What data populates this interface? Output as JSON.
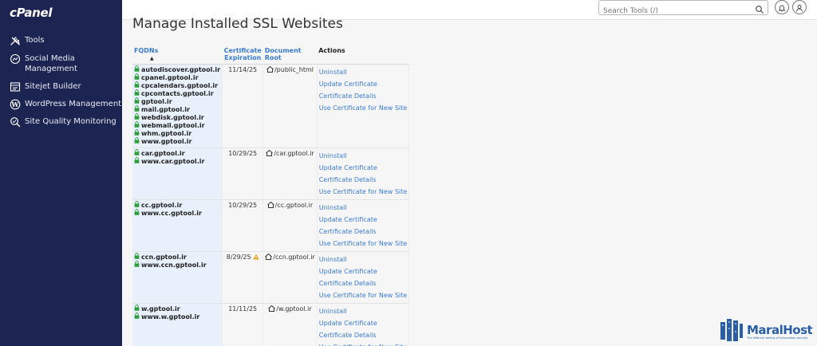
{
  "app": {
    "logo": "cPanel"
  },
  "sidebar": {
    "items": [
      {
        "label": "Tools",
        "icon": "tools-icon"
      },
      {
        "label": "Social Media Management",
        "icon": "social-media-icon"
      },
      {
        "label": "Sitejet Builder",
        "icon": "sitejet-icon"
      },
      {
        "label": "WordPress Management",
        "icon": "wordpress-icon"
      },
      {
        "label": "Site Quality Monitoring",
        "icon": "site-quality-icon"
      }
    ]
  },
  "topbar": {
    "search_placeholder": "Search Tools (/)"
  },
  "page": {
    "title": "Manage Installed SSL Websites"
  },
  "table": {
    "headers": {
      "fqdns": "FQDNs",
      "expiration": "Certificate Expiration",
      "doc_root": "Document Root",
      "actions": "Actions"
    },
    "rows": [
      {
        "fqdns": [
          "autodiscover.gptool.ir",
          "cpanel.gptool.ir",
          "cpcalendars.gptool.ir",
          "cpcontacts.gptool.ir",
          "gptool.ir",
          "mail.gptool.ir",
          "webdisk.gptool.ir",
          "webmail.gptool.ir",
          "whm.gptool.ir",
          "www.gptool.ir"
        ],
        "expiration": "11/14/25",
        "warning": false,
        "doc_root": "/public_html"
      },
      {
        "fqdns": [
          "car.gptool.ir",
          "www.car.gptool.ir"
        ],
        "expiration": "10/29/25",
        "warning": false,
        "doc_root": "/car.gptool.ir"
      },
      {
        "fqdns": [
          "cc.gptool.ir",
          "www.cc.gptool.ir"
        ],
        "expiration": "10/29/25",
        "warning": false,
        "doc_root": "/cc.gptool.ir"
      },
      {
        "fqdns": [
          "ccn.gptool.ir",
          "www.ccn.gptool.ir"
        ],
        "expiration": "8/29/25",
        "warning": true,
        "doc_root": "/ccn.gptool.ir"
      },
      {
        "fqdns": [
          "w.gptool.ir",
          "www.w.gptool.ir"
        ],
        "expiration": "11/11/25",
        "warning": false,
        "doc_root": "/w.gptool.ir"
      }
    ],
    "actions": [
      "Uninstall",
      "Update Certificate",
      "Certificate Details",
      "Use Certificate for New Site"
    ]
  },
  "watermark": {
    "name": "MaralHost",
    "tagline": "The different feeling of information security"
  },
  "colors": {
    "sidebar_bg": "#1c2551",
    "link": "#3a7bd5",
    "fqdn_bg": "#e8f1fb",
    "lock": "#2e9e3a",
    "warning": "#e8a317"
  }
}
